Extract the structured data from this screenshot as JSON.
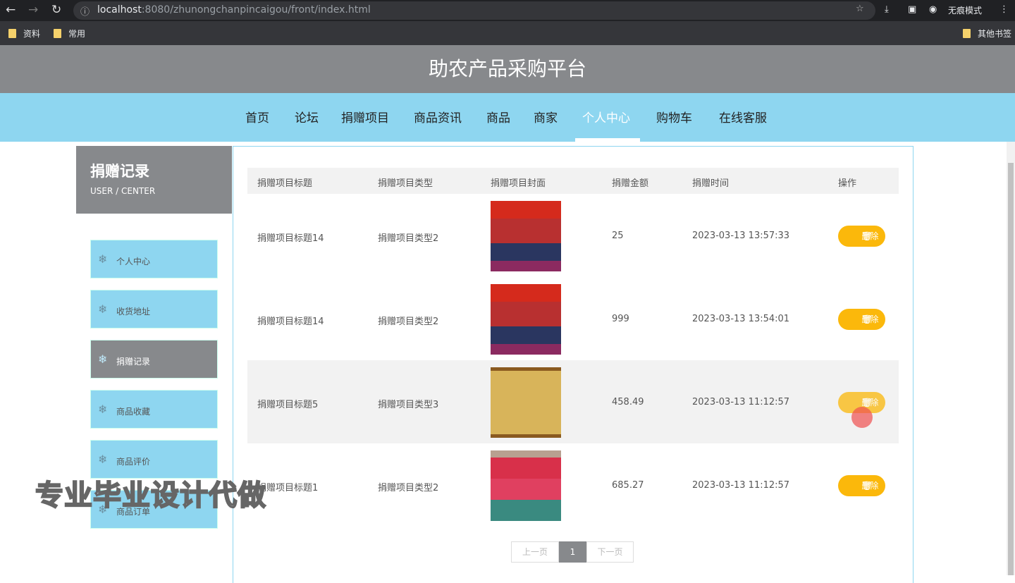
{
  "browser": {
    "url_host": "localhost",
    "url_rest": ":8080/zhunongchanpincaigou/front/index.html",
    "incognito": "无痕模式",
    "bookmarks": [
      "资料",
      "常用"
    ],
    "other_bookmarks": "其他书签"
  },
  "site": {
    "title": "助农产品采购平台"
  },
  "nav": [
    "首页",
    "论坛",
    "捐赠项目",
    "商品资讯",
    "商品",
    "商家",
    "个人中心",
    "购物车",
    "在线客服"
  ],
  "sidebar": {
    "title": "捐赠记录",
    "subtitle": "USER / CENTER",
    "items": [
      "个人中心",
      "收货地址",
      "捐赠记录",
      "商品收藏",
      "商品评价",
      "商品订单"
    ]
  },
  "table": {
    "headers": [
      "捐赠项目标题",
      "捐赠项目类型",
      "捐赠项目封面",
      "捐赠金额",
      "捐赠时间",
      "操作"
    ],
    "rows": [
      {
        "title": "捐赠项目标题14",
        "type": "捐赠项目类型2",
        "amount": "25",
        "time": "2023-03-13 13:57:33"
      },
      {
        "title": "捐赠项目标题14",
        "type": "捐赠项目类型2",
        "amount": "999",
        "time": "2023-03-13 13:54:01"
      },
      {
        "title": "捐赠项目标题5",
        "type": "捐赠项目类型3",
        "amount": "458.49",
        "time": "2023-03-13 11:12:57"
      },
      {
        "title": "捐赠项目标题1",
        "type": "捐赠项目类型2",
        "amount": "685.27",
        "time": "2023-03-13 11:12:57"
      }
    ],
    "delete_label": "删除"
  },
  "pagination": {
    "prev": "上一页",
    "current": "1",
    "next": "下一页"
  },
  "watermark": "专业毕业设计代做"
}
